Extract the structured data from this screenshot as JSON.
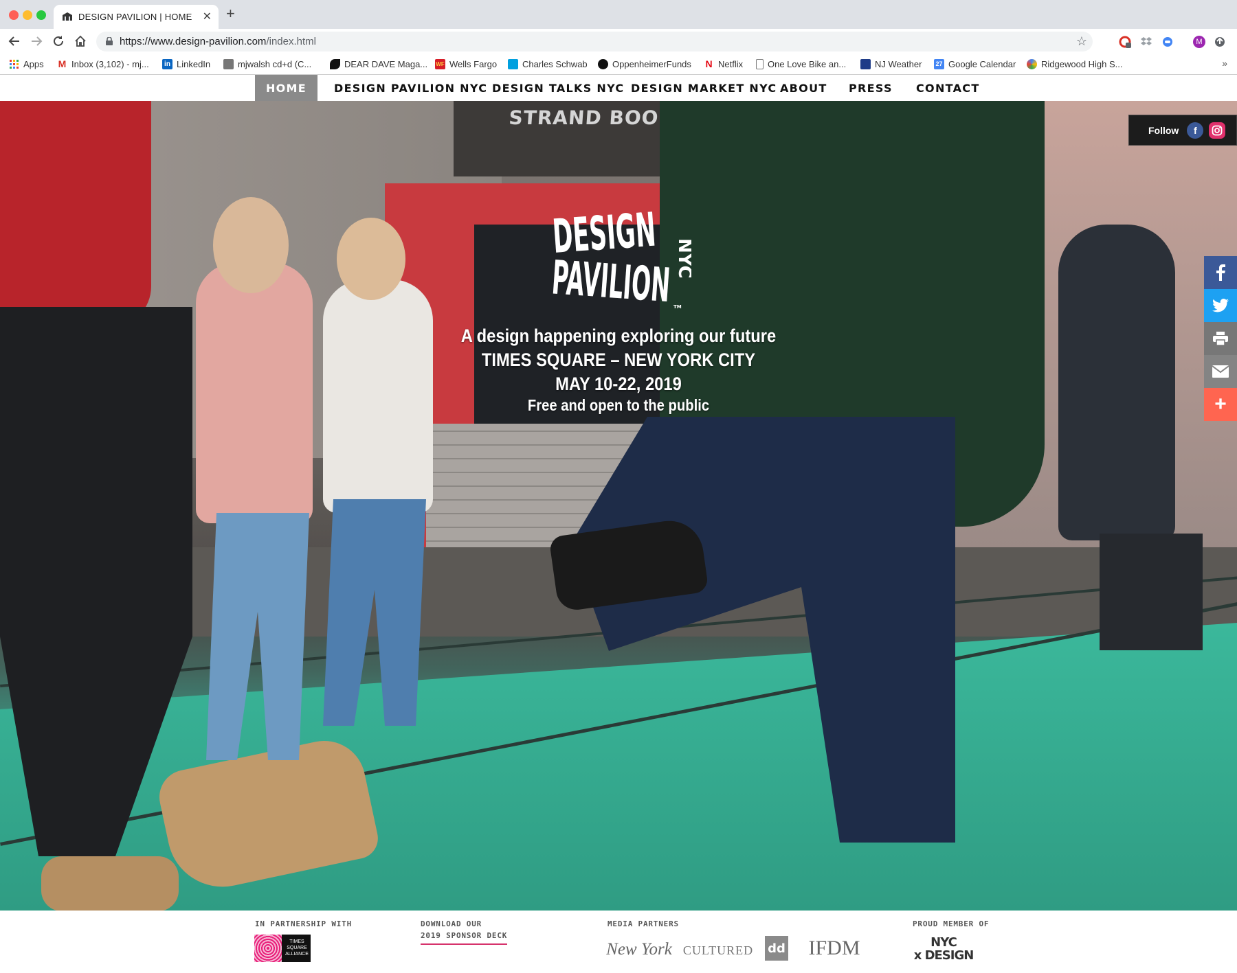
{
  "browser": {
    "tab_title": "DESIGN PAVILION  |  HOME",
    "url_main": "https://www.design-pavilion.com",
    "url_path": "/index.html",
    "profile_initial": "M"
  },
  "bookmarks": [
    {
      "label": "Apps",
      "icon": "apps-grid-icon"
    },
    {
      "label": "Inbox (3,102) - mj...",
      "icon": "gmail-icon"
    },
    {
      "label": "LinkedIn",
      "icon": "linkedin-icon"
    },
    {
      "label": "mjwalsh cd+d (C...",
      "icon": "bookmark-site-icon"
    },
    {
      "label": "DEAR DAVE Maga...",
      "icon": "leaf-icon"
    },
    {
      "label": "Wells Fargo",
      "icon": "wells-fargo-icon"
    },
    {
      "label": "Charles Schwab",
      "icon": "schwab-icon"
    },
    {
      "label": "OppenheimerFunds",
      "icon": "oppenheimer-icon"
    },
    {
      "label": "Netflix",
      "icon": "netflix-icon"
    },
    {
      "label": "One Love Bike an...",
      "icon": "page-icon"
    },
    {
      "label": "NJ Weather",
      "icon": "weather-icon"
    },
    {
      "label": "Google Calendar",
      "icon": "calendar-icon"
    },
    {
      "label": "Ridgewood High S...",
      "icon": "school-icon"
    }
  ],
  "calendar_day": "27",
  "nav": {
    "items": [
      "HOME",
      "DESIGN PAVILION NYC",
      "DESIGN TALKS NYC",
      "DESIGN MARKET NYC",
      "ABOUT",
      "PRESS",
      "CONTACT"
    ]
  },
  "hero": {
    "logo_line1": "DESIGN",
    "logo_line2": "PAVILION",
    "logo_nyc": "NYC",
    "logo_tm": "TM",
    "tagline": "A design happening exploring our future",
    "location": "TIMES SQUARE – NEW YORK CITY",
    "dates": "MAY 10-22, 2019",
    "admission": "Free and open to the public",
    "sign_text": "STRAND BOOK",
    "follow_label": "Follow"
  },
  "footer": {
    "partnership_label": "IN PARTNERSHIP WITH",
    "sponsor_label_1": "DOWNLOAD OUR",
    "sponsor_label_2": "2019 SPONSOR DECK",
    "media_label": "MEDIA PARTNERS",
    "member_label": "PROUD MEMBER OF",
    "times_square_logo": "TIMES SQUARE ALLIANCE",
    "media_logos": [
      "New York",
      "CULTURED",
      "dd",
      "IFDM"
    ],
    "nyc_design_1": "NYC",
    "nyc_design_2": "x DESIGN"
  },
  "colors": {
    "nav_active_bg": "#8a8a8a",
    "accent_pink": "#d6336c",
    "facebook": "#3b5998",
    "twitter": "#1da1f2",
    "print": "#777777",
    "email": "#848484",
    "more": "#ff6550"
  }
}
